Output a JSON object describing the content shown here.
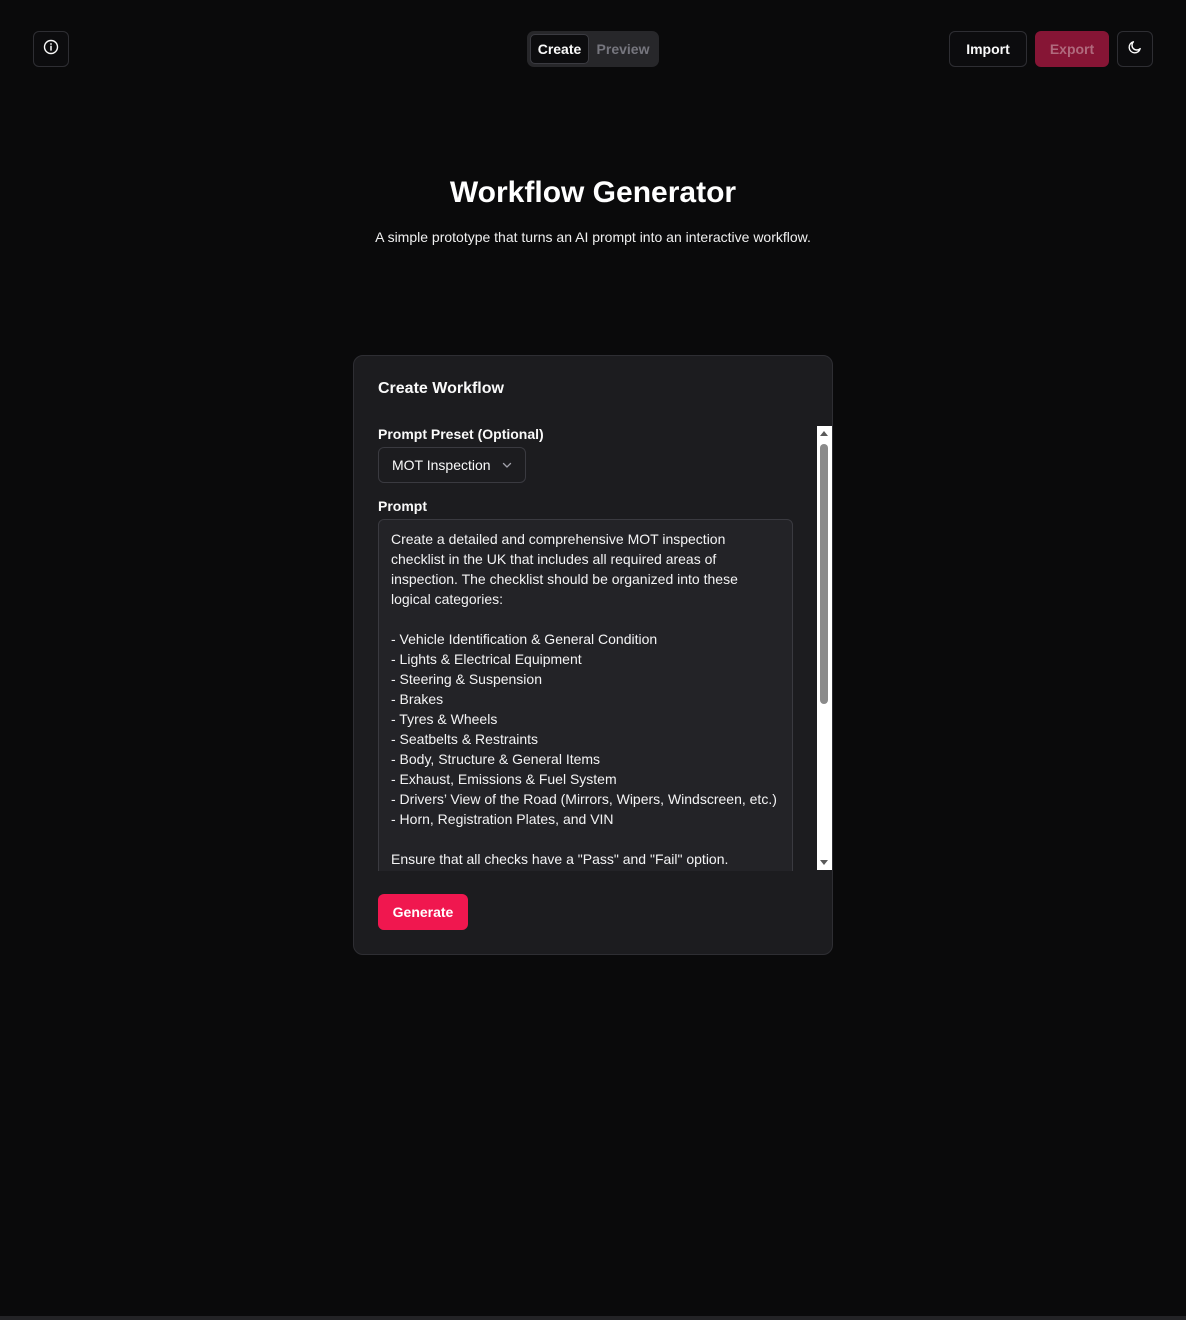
{
  "header": {
    "info_icon": "info-icon",
    "tabs": [
      {
        "label": "Create",
        "active": true
      },
      {
        "label": "Preview",
        "active": false
      }
    ],
    "import_label": "Import",
    "export_label": "Export",
    "theme_icon": "moon-icon"
  },
  "hero": {
    "title": "Workflow Generator",
    "subtitle": "A simple prototype that turns an AI prompt into an interactive workflow."
  },
  "card": {
    "title": "Create Workflow",
    "preset_label": "Prompt Preset (Optional)",
    "preset_value": "MOT Inspection",
    "prompt_label": "Prompt",
    "prompt_value": "Create a detailed and comprehensive MOT inspection checklist in the UK that includes all required areas of inspection. The checklist should be organized into these logical categories:\n\n- Vehicle Identification & General Condition\n- Lights & Electrical Equipment\n- Steering & Suspension\n- Brakes\n- Tyres & Wheels\n- Seatbelts & Restraints\n- Body, Structure & General Items\n- Exhaust, Emissions & Fuel System\n- Drivers’ View of the Road (Mirrors, Wipers, Windscreen, etc.)\n- Horn, Registration Plates, and VIN\n\nEnsure that all checks have a \"Pass\" and \"Fail\" option.",
    "generate_label": "Generate"
  },
  "colors": {
    "background": "#0a0a0b",
    "card": "#1c1c1f",
    "accent": "#f0174f",
    "export_disabled": "#861535"
  }
}
